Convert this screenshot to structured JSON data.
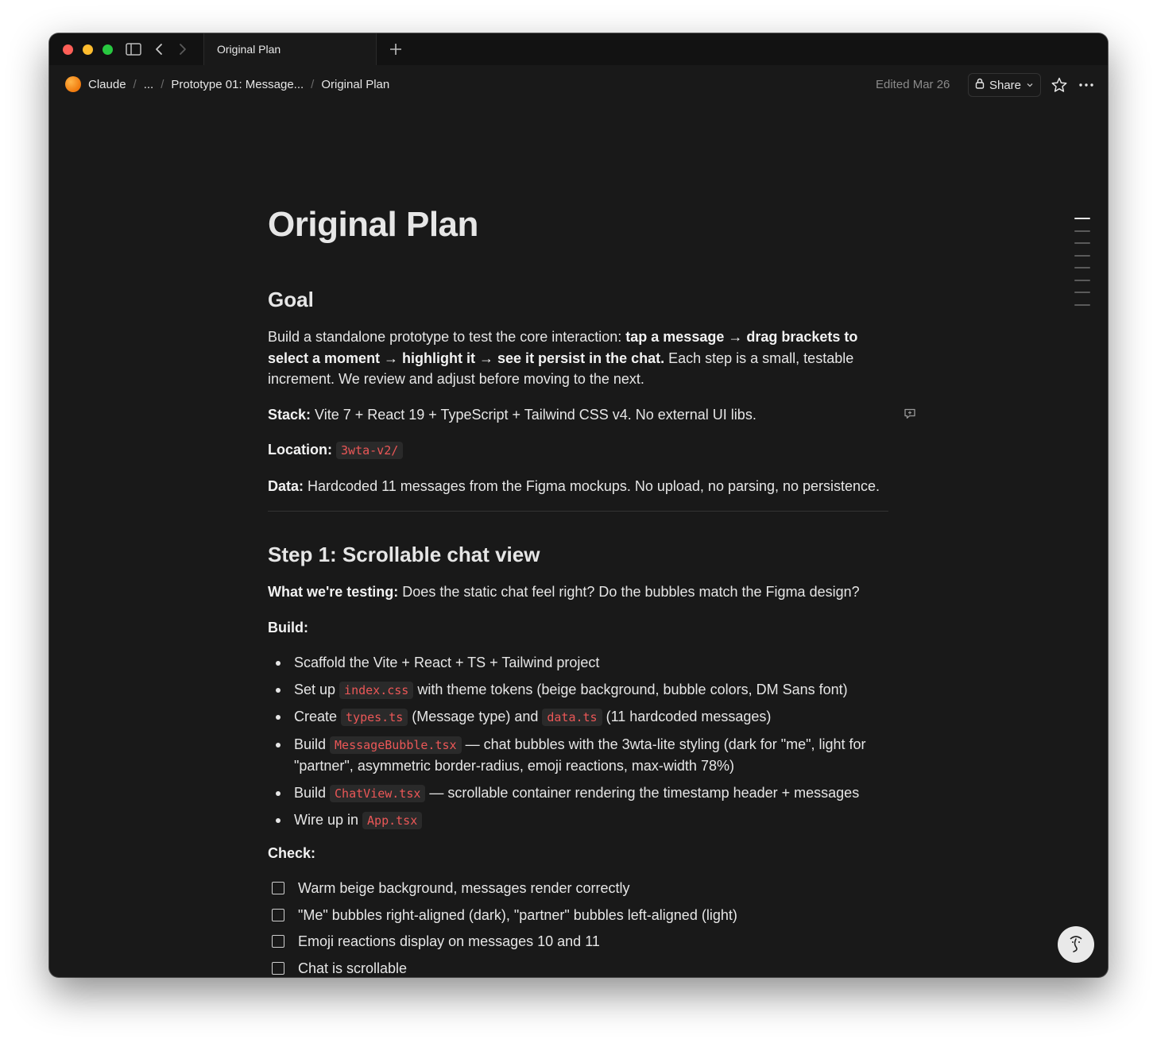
{
  "tab": {
    "title": "Original Plan"
  },
  "breadcrumb": {
    "workspace": "Claude",
    "ellipsis": "...",
    "parent": "Prototype 01: Message...",
    "current": "Original Plan"
  },
  "header": {
    "edited": "Edited Mar 26",
    "share_label": "Share"
  },
  "colors": {
    "background": "#191919",
    "tabbar": "#121212",
    "text": "#e6e6e6",
    "code": "#eb5757",
    "code_bg": "#2a2a2a"
  },
  "doc": {
    "title": "Original Plan",
    "goal": {
      "heading": "Goal",
      "p1": {
        "t1": "Build a standalone prototype to test the core interaction: ",
        "b1": "tap a message → drag brackets to select a moment → highlight it → see it persist in the chat.",
        "t2": " Each step is a small, testable increment. We review and adjust before moving to the next."
      },
      "stack": {
        "label": "Stack:",
        "text": " Vite 7 + React 19 + TypeScript + Tailwind CSS v4. No external UI libs."
      },
      "location": {
        "label": "Location:",
        "code": "3wta-v2/"
      },
      "data": {
        "label": "Data:",
        "text": " Hardcoded 11 messages from the Figma mockups. No upload, no parsing, no persistence."
      }
    },
    "step1": {
      "heading": "Step 1: Scrollable chat view",
      "testing": {
        "label": "What we're testing:",
        "text": " Does the static chat feel right? Do the bubbles match the Figma design?"
      },
      "build_label": "Build:",
      "build": {
        "i1": "Scaffold the Vite + React + TS + Tailwind project",
        "i2a": "Set up ",
        "i2code": "index.css",
        "i2b": " with theme tokens (beige background, bubble colors, DM Sans font)",
        "i3a": "Create ",
        "i3code1": "types.ts",
        "i3b": " (Message type) and ",
        "i3code2": "data.ts",
        "i3c": " (11 hardcoded messages)",
        "i4a": "Build ",
        "i4code": "MessageBubble.tsx",
        "i4b": " — chat bubbles with the 3wta-lite styling (dark for \"me\", light for \"partner\", asymmetric border-radius, emoji reactions, max-width 78%)",
        "i5a": "Build ",
        "i5code": "ChatView.tsx",
        "i5b": " — scrollable container rendering the timestamp header + messages",
        "i6a": "Wire up in ",
        "i6code": "App.tsx"
      },
      "check_label": "Check:",
      "checks": [
        "Warm beige background, messages render correctly",
        "\"Me\" bubbles right-aligned (dark), \"partner\" bubbles left-aligned (light)",
        "Emoji reactions display on messages 10 and 11",
        "Chat is scrollable"
      ]
    }
  }
}
